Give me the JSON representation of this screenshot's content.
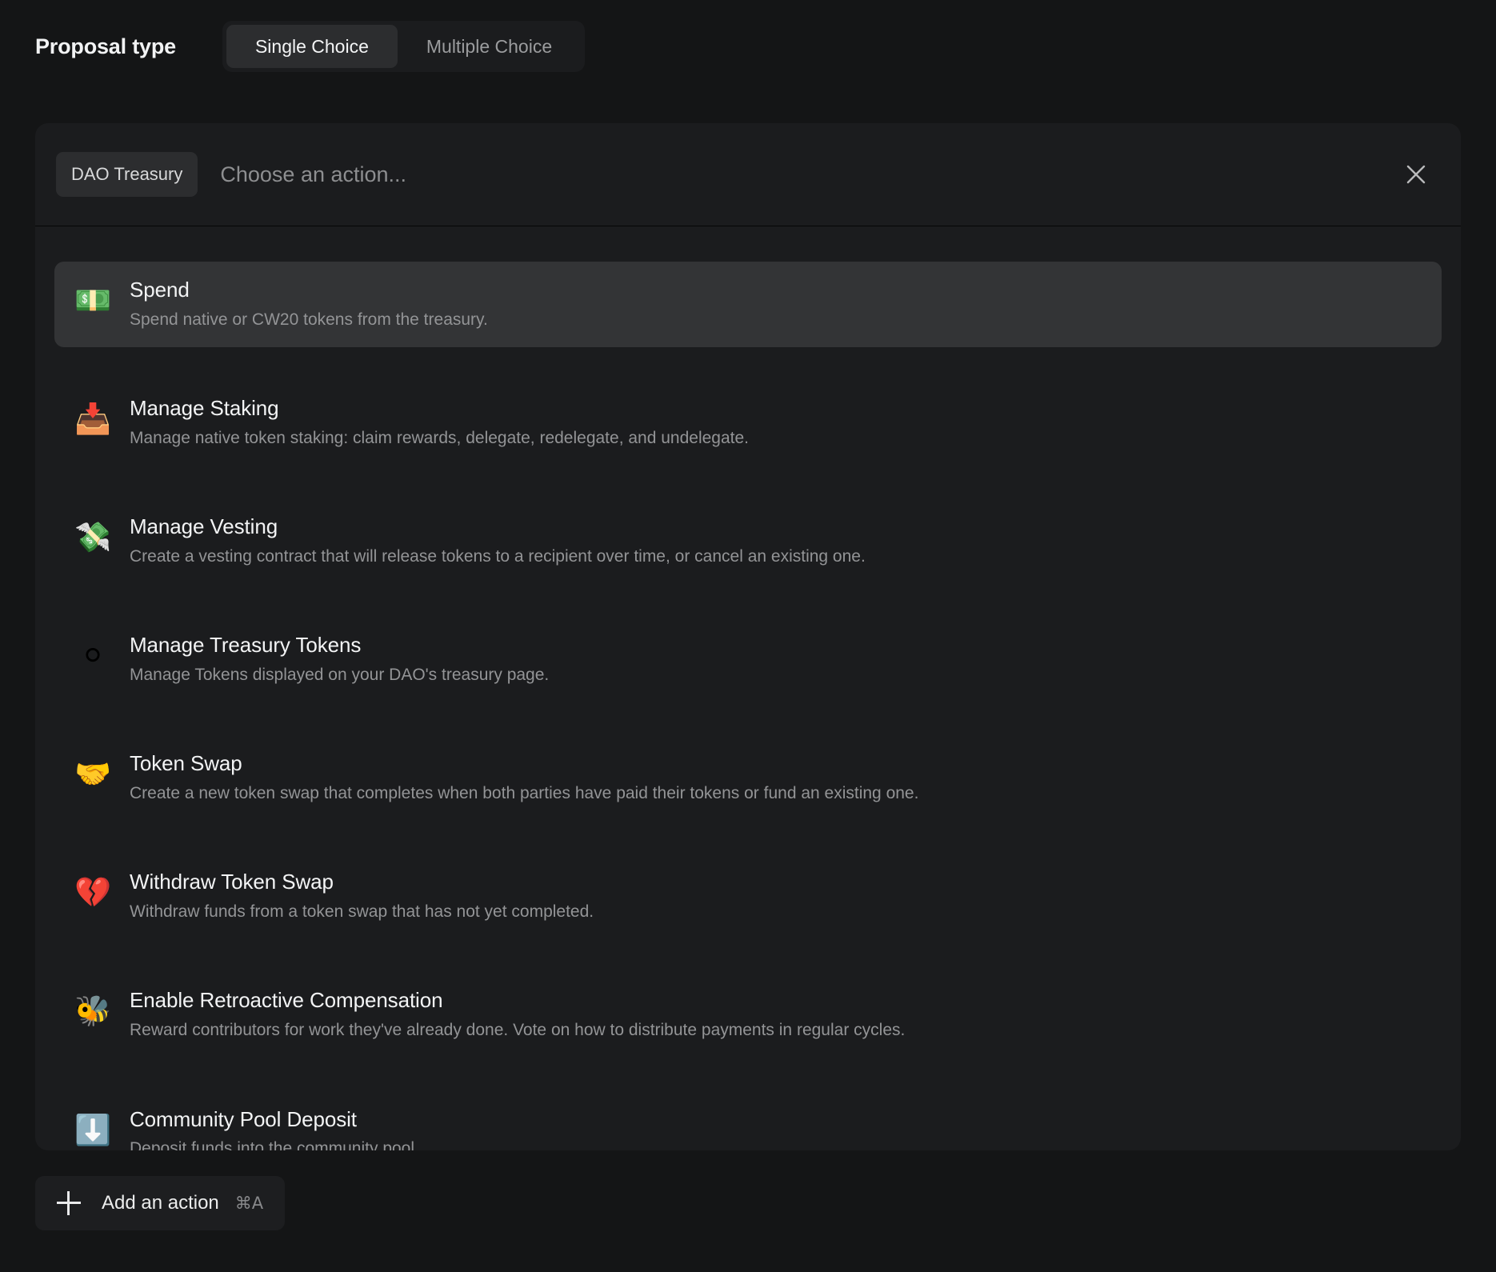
{
  "header": {
    "label": "Proposal type",
    "segments": [
      {
        "label": "Single Choice",
        "active": true
      },
      {
        "label": "Multiple Choice",
        "active": false
      }
    ]
  },
  "picker": {
    "dao_chip": "DAO Treasury",
    "search_placeholder": "Choose an action...",
    "search_value": "",
    "close_icon": "close-icon",
    "actions": [
      {
        "emoji": "💵",
        "icon_name": "banknote-emoji",
        "title": "Spend",
        "description": "Spend native or CW20 tokens from the treasury.",
        "selected": true
      },
      {
        "emoji": "📥",
        "icon_name": "inbox-tray-emoji",
        "title": "Manage Staking",
        "description": "Manage native token staking: claim rewards, delegate, redelegate, and undelegate.",
        "selected": false
      },
      {
        "emoji": "💸",
        "icon_name": "money-with-wings-emoji",
        "title": "Manage Vesting",
        "description": "Create a vesting contract that will release tokens to a recipient over time, or cancel an existing one.",
        "selected": false
      },
      {
        "emoji": "⚪",
        "icon_name": "white-circle-emoji",
        "title": "Manage Treasury Tokens",
        "description": "Manage Tokens displayed on your DAO's treasury page.",
        "selected": false
      },
      {
        "emoji": "🤝",
        "icon_name": "handshake-emoji",
        "title": "Token Swap",
        "description": "Create a new token swap that completes when both parties have paid their tokens or fund an existing one.",
        "selected": false
      },
      {
        "emoji": "💔",
        "icon_name": "broken-heart-emoji",
        "title": "Withdraw Token Swap",
        "description": "Withdraw funds from a token swap that has not yet completed.",
        "selected": false
      },
      {
        "emoji": "🐝",
        "icon_name": "honeybee-emoji",
        "title": "Enable Retroactive Compensation",
        "description": "Reward contributors for work they've already done. Vote on how to distribute payments in regular cycles.",
        "selected": false
      },
      {
        "emoji": "⬇️",
        "icon_name": "down-arrow-emoji",
        "title": "Community Pool Deposit",
        "description": "Deposit funds into the community pool.",
        "selected": false
      }
    ]
  },
  "footer": {
    "add_action_label": "Add an action",
    "add_action_shortcut": "⌘A"
  },
  "colors": {
    "page_background": "#141516",
    "panel_background": "#1b1c1e",
    "selected_row": "#333436",
    "chip_background": "#2c2d2f",
    "title_text": "#f3f4f5",
    "muted_text": "#939496"
  }
}
